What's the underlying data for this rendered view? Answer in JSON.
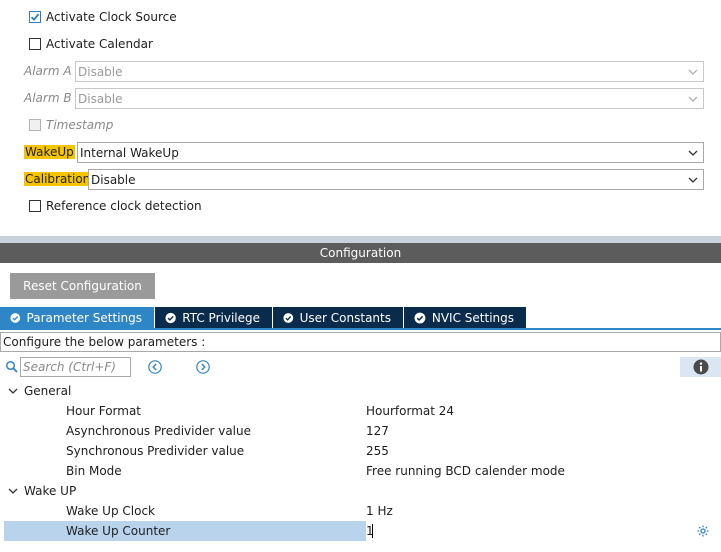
{
  "mode": {
    "activate_clock_source": {
      "label": "Activate Clock Source",
      "checked": true
    },
    "activate_calendar": {
      "label": "Activate Calendar",
      "checked": false
    },
    "alarm_a": {
      "label": "Alarm A",
      "value": "Disable"
    },
    "alarm_b": {
      "label": "Alarm B",
      "value": "Disable"
    },
    "timestamp": {
      "label": "Timestamp",
      "checked": false
    },
    "wakeup": {
      "label": "WakeUp",
      "value": "Internal WakeUp"
    },
    "calibration": {
      "label": "Calibration",
      "value": "Disable"
    },
    "reference_clock_detection": {
      "label": "Reference clock detection",
      "checked": false
    }
  },
  "configuration": {
    "title": "Configuration",
    "reset_button": "Reset Configuration",
    "tabs": [
      {
        "label": "Parameter Settings",
        "active": true
      },
      {
        "label": "RTC Privilege",
        "active": false
      },
      {
        "label": "User Constants",
        "active": false
      },
      {
        "label": "NVIC Settings",
        "active": false
      }
    ],
    "configure_text": "Configure the below parameters :",
    "search_placeholder": "Search (Ctrl+F)",
    "groups": [
      {
        "name": "General",
        "params": [
          {
            "name": "Hour Format",
            "value": "Hourformat 24"
          },
          {
            "name": "Asynchronous Predivider value",
            "value": "127"
          },
          {
            "name": "Synchronous Predivider value",
            "value": "255"
          },
          {
            "name": "Bin Mode",
            "value": "Free running BCD calender mode"
          }
        ]
      },
      {
        "name": "Wake UP",
        "params": [
          {
            "name": "Wake Up Clock",
            "value": "1 Hz"
          },
          {
            "name": "Wake Up Counter",
            "value": "1"
          }
        ]
      }
    ]
  },
  "colors": {
    "highlight": "#f5c400",
    "tab_active": "#2f86c7",
    "tab_inactive": "#0b2b4c",
    "selected_row": "#b9d3ec",
    "config_bar": "#5c5c5c"
  }
}
